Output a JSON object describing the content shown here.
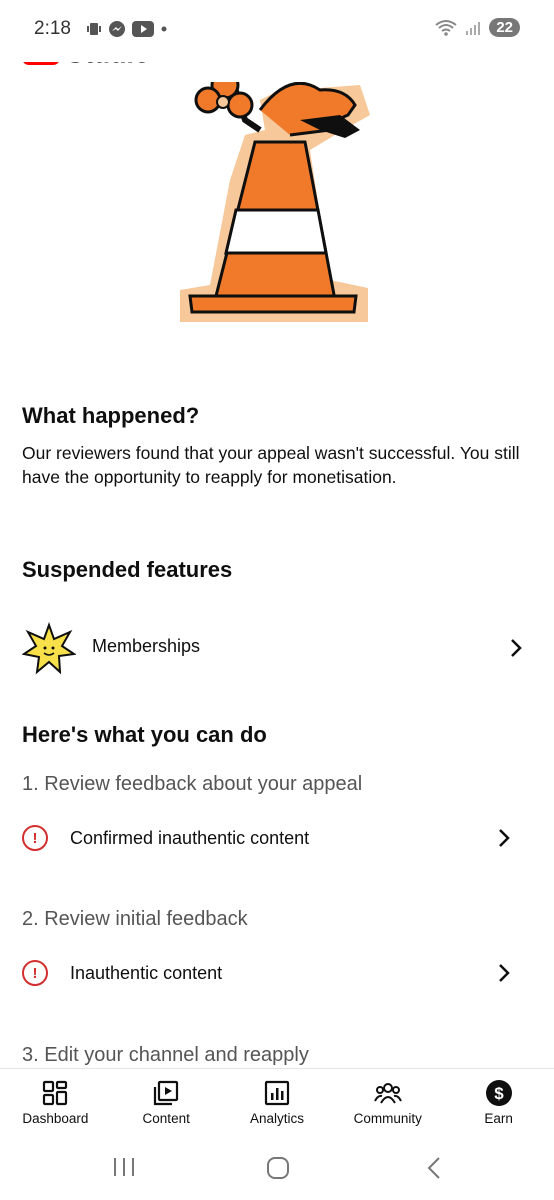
{
  "status_bar": {
    "time": "2:18",
    "battery": "22"
  },
  "header": {
    "app_name": "Studio"
  },
  "what_happened": {
    "title": "What happened?",
    "body": "Our reviewers found that your appeal wasn't successful. You still have the opportunity to reapply for monetisation."
  },
  "suspended": {
    "title": "Suspended features",
    "items": [
      {
        "label": "Memberships",
        "icon": "star-sticker-icon"
      }
    ]
  },
  "what_to_do": {
    "title": "Here's what you can do",
    "steps": [
      {
        "title": "1. Review feedback about your appeal",
        "item": "Confirmed inauthentic content"
      },
      {
        "title": "2. Review initial feedback",
        "item": "Inauthentic content"
      },
      {
        "title": "3. Edit your channel and reapply"
      }
    ]
  },
  "bottom_nav": {
    "items": [
      {
        "label": "Dashboard",
        "icon": "dashboard-icon"
      },
      {
        "label": "Content",
        "icon": "content-icon"
      },
      {
        "label": "Analytics",
        "icon": "analytics-icon"
      },
      {
        "label": "Community",
        "icon": "community-icon"
      },
      {
        "label": "Earn",
        "icon": "earn-icon"
      }
    ]
  },
  "colors": {
    "brand_red": "#ff0000",
    "alert_red": "#d32f2f",
    "cone_orange": "#f07a2a",
    "cone_backdrop": "#f7c89a"
  }
}
